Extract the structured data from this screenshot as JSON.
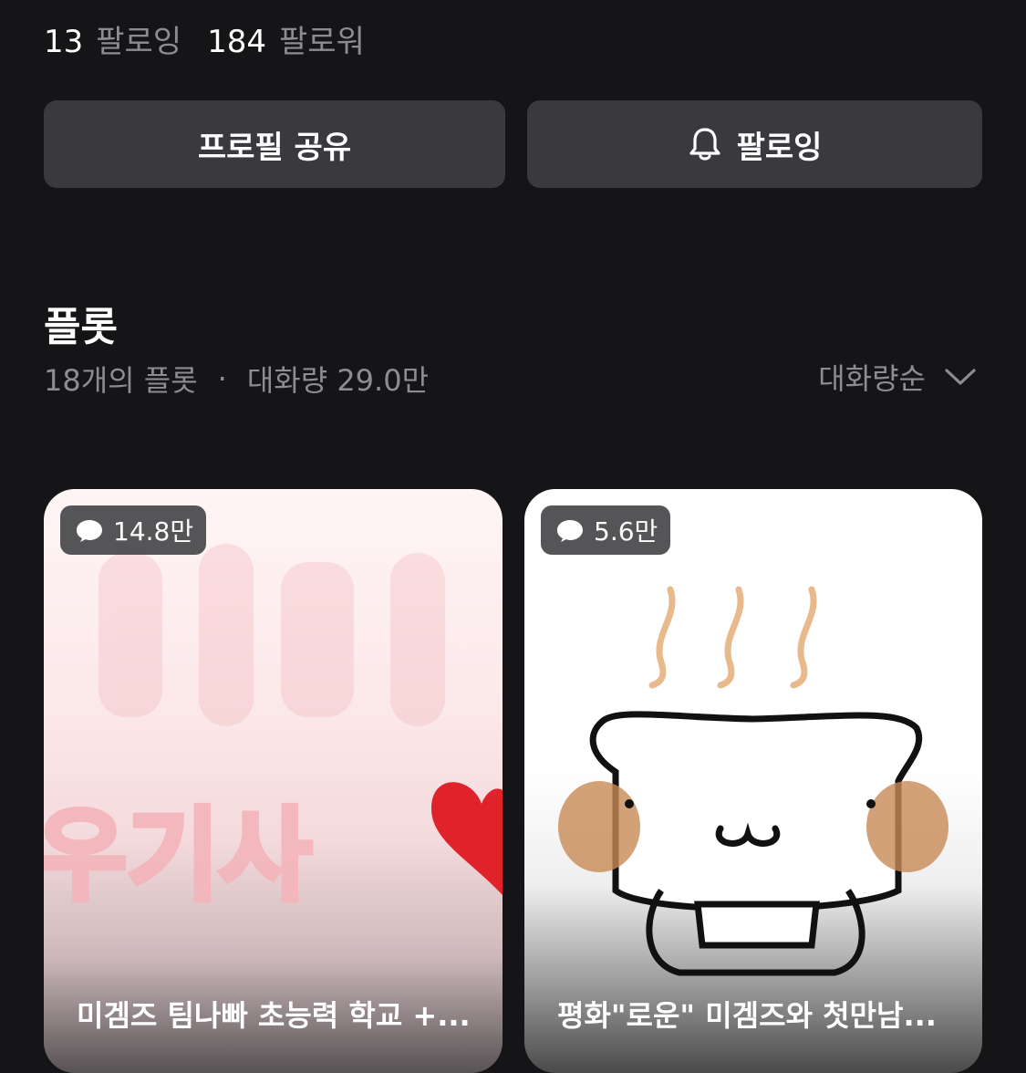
{
  "profile": {
    "following_count": "13",
    "following_label": "팔로잉",
    "follower_count": "184",
    "follower_label": "팔로워"
  },
  "actions": {
    "share_label": "프로필 공유",
    "follow_label": "팔로잉",
    "follow_icon": "bell-icon"
  },
  "section": {
    "title": "플롯",
    "count_text": "18개의 플롯",
    "separator": "·",
    "volume_text": "대화량 29.0만",
    "sort_label": "대화량순",
    "sort_icon": "chevron-down-icon"
  },
  "cards": [
    {
      "chat_count": "14.8만",
      "chat_icon": "chat-bubble-icon",
      "image_text": "우기사",
      "title": "미겜즈 팀나빠 초능력 학교 +..."
    },
    {
      "chat_count": "5.6만",
      "chat_icon": "chat-bubble-icon",
      "title": "평화\"로운\" 미겜즈와 첫만남..."
    }
  ]
}
